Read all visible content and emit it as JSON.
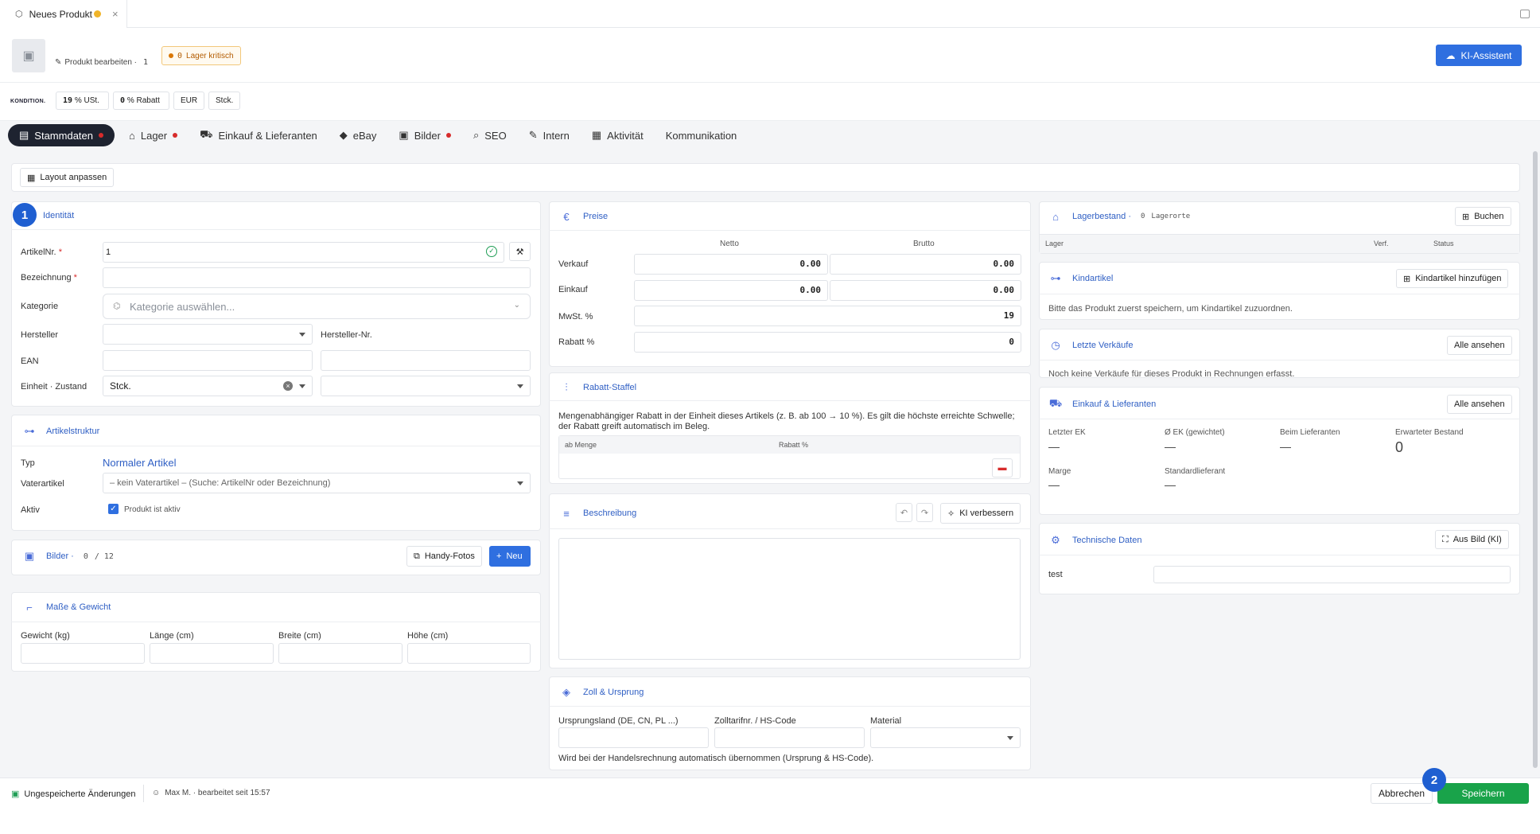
{
  "tab": {
    "title": "Neues Produkt",
    "close": "×"
  },
  "header": {
    "edit_label": "Produkt bearbeiten ·",
    "edit_count": "1",
    "stock_count": "0",
    "stock_label": "Lager kritisch",
    "ki_button": "KI-Assistent"
  },
  "conditions": {
    "label": "KONDITION.",
    "vat": "19",
    "vat_unit": "% USt.",
    "discount": "0",
    "discount_unit": "% Rabatt",
    "currency": "EUR",
    "unit": "Stck."
  },
  "main_tabs": [
    {
      "label": "Stammdaten",
      "dot": true,
      "icon": "document-icon"
    },
    {
      "label": "Lager",
      "dot": true,
      "icon": "warehouse-icon"
    },
    {
      "label": "Einkauf & Lieferanten",
      "dot": false,
      "icon": "cart-icon"
    },
    {
      "label": "eBay",
      "dot": false,
      "icon": "tag-icon"
    },
    {
      "label": "Bilder",
      "dot": true,
      "icon": "image-icon"
    },
    {
      "label": "SEO",
      "dot": false,
      "icon": "seo-icon"
    },
    {
      "label": "Intern",
      "dot": false,
      "icon": "note-icon"
    },
    {
      "label": "Aktivität",
      "dot": false,
      "icon": "activity-icon"
    },
    {
      "label": "Kommunikation",
      "dot": false,
      "icon": ""
    }
  ],
  "layout_button": "Layout anpassen",
  "identity": {
    "step": "1",
    "title": "Identität",
    "artnr_label": "ArtikelNr.",
    "artnr_value": "1",
    "name_label": "Bezeichnung",
    "category_label": "Kategorie",
    "category_placeholder": "Kategorie auswählen...",
    "maker_label": "Hersteller",
    "maker_nr_label": "Hersteller-Nr.",
    "ean_label": "EAN",
    "unit_label": "Einheit · Zustand",
    "unit_value": "Stck."
  },
  "structure": {
    "title": "Artikelstruktur",
    "type_label": "Typ",
    "type_value": "Normaler Artikel",
    "parent_label": "Vaterartikel",
    "parent_value": "– kein Vaterartikel – (Suche: ArtikelNr oder Bezeichnung)",
    "active_label": "Aktiv",
    "active_checkbox": "Produkt ist aktiv"
  },
  "images": {
    "title": "Bilder ·",
    "count": "0",
    "sep": "/",
    "max": "12",
    "phone_button": "Handy-Fotos",
    "new_button": "Neu"
  },
  "dimensions": {
    "title": "Maße & Gewicht",
    "weight": "Gewicht (kg)",
    "length": "Länge (cm)",
    "width": "Breite (cm)",
    "height": "Höhe (cm)"
  },
  "prices": {
    "title": "Preise",
    "netto": "Netto",
    "brutto": "Brutto",
    "sale_label": "Verkauf",
    "sale_net": "0.00",
    "sale_gross": "0.00",
    "buy_label": "Einkauf",
    "buy_net": "0.00",
    "buy_gross": "0.00",
    "vat_label": "MwSt. %",
    "vat_value": "19",
    "discount_label": "Rabatt %",
    "discount_value": "0"
  },
  "tiers": {
    "title": "Rabatt-Staffel",
    "desc1": "Mengenabhängiger Rabatt in der Einheit dieses Artikels (z. B. ab 100 → 10 %). Es gilt die höchste erreichte Schwelle;",
    "desc2": "der Rabatt greift automatisch im Beleg.",
    "col_qty": "ab Menge",
    "col_rate": "Rabatt %"
  },
  "description": {
    "title": "Beschreibung",
    "ki_button": "KI verbessern"
  },
  "customs": {
    "title": "Zoll & Ursprung",
    "origin": "Ursprungsland (DE, CN, PL ...)",
    "hs": "Zolltarifnr. / HS-Code",
    "material": "Material",
    "note": "Wird bei der Handelsrechnung automatisch übernommen (Ursprung & HS-Code)."
  },
  "stock": {
    "title": "Lagerbestand ·",
    "count": "0",
    "locations": "Lagerorte",
    "book_button": "Buchen",
    "col_stock": "Lager",
    "col_avail": "Verf.",
    "col_status": "Status"
  },
  "children": {
    "title": "Kindartikel",
    "add_button": "Kindartikel hinzufügen",
    "note": "Bitte das Produkt zuerst speichern, um Kindartikel zuzuordnen."
  },
  "sales": {
    "title": "Letzte Verkäufe",
    "all_button": "Alle ansehen",
    "note": "Noch keine Verkäufe für dieses Produkt in Rechnungen erfasst."
  },
  "purchase": {
    "title": "Einkauf & Lieferanten",
    "all_button": "Alle ansehen",
    "last_ek": "Letzter EK",
    "avg_ek": "Ø EK (gewichtet)",
    "at_supplier": "Beim Lieferanten",
    "expected": "Erwarteter Bestand",
    "dash": "—",
    "expected_value": "0",
    "margin": "Marge",
    "std_supplier": "Standardlieferant"
  },
  "tech": {
    "title": "Technische Daten",
    "from_image_button": "Aus Bild (KI)",
    "row_label": "test"
  },
  "footer": {
    "unsaved": "Ungespeicherte Änderungen",
    "user": "Max M. · bearbeitet seit 15:57",
    "cancel": "Abbrechen",
    "save": "Speichern",
    "save_step": "2"
  }
}
